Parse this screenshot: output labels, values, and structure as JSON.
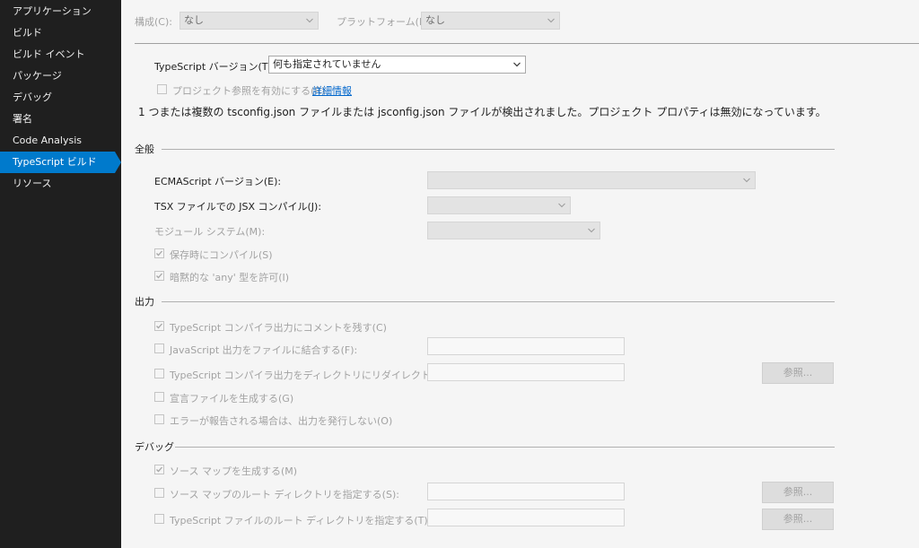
{
  "sidebar": {
    "items": [
      {
        "label": "アプリケーション"
      },
      {
        "label": "ビルド"
      },
      {
        "label": "ビルド イベント"
      },
      {
        "label": "パッケージ"
      },
      {
        "label": "デバッグ"
      },
      {
        "label": "署名"
      },
      {
        "label": "Code Analysis"
      },
      {
        "label": "TypeScript ビルド"
      },
      {
        "label": "リソース"
      }
    ],
    "active_index": 7
  },
  "header": {
    "config_label": "構成(C):",
    "config_value": "なし",
    "platform_label": "プラットフォーム(M):",
    "platform_value": "なし"
  },
  "ts_version": {
    "label": "TypeScript バージョン(T):",
    "value": "何も指定されていません"
  },
  "project_ref": {
    "label": "プロジェクト参照を有効にする(R)",
    "link": "詳細情報",
    "checked": false
  },
  "notice": "1 つまたは複数の tsconfig.json ファイルまたは jsconfig.json ファイルが検出されました。プロジェクト プロパティは無効になっています。",
  "general": {
    "title": "全般",
    "ecmascript_label": "ECMAScript バージョン(E):",
    "ecmascript_value": "",
    "jsx_label": "TSX ファイルでの JSX コンパイル(J):",
    "jsx_value": "",
    "module_label": "モジュール システム(M):",
    "module_value": "",
    "compile_on_save": {
      "label": "保存時にコンパイル(S)",
      "checked": true
    },
    "implicit_any": {
      "label": "暗黙的な 'any' 型を許可(I)",
      "checked": true
    }
  },
  "output": {
    "title": "出力",
    "keep_comments": {
      "label": "TypeScript コンパイラ出力にコメントを残す(C)",
      "checked": true
    },
    "combine_js": {
      "label": "JavaScript 出力をファイルに結合する(F):",
      "checked": false,
      "value": ""
    },
    "redirect_output": {
      "label": "TypeScript コンパイラ出力をディレクトリにリダイレクトする(D):",
      "checked": false,
      "value": ""
    },
    "browse_label": "参照...",
    "declaration": {
      "label": "宣言ファイルを生成する(G)",
      "checked": false
    },
    "no_emit_on_error": {
      "label": "エラーが報告される場合は、出力を発行しない(O)",
      "checked": false
    }
  },
  "debug": {
    "title": "デバッグ",
    "source_map": {
      "label": "ソース マップを生成する(M)",
      "checked": true
    },
    "map_root": {
      "label": "ソース マップのルート ディレクトリを指定する(S):",
      "checked": false,
      "value": ""
    },
    "ts_root": {
      "label": "TypeScript ファイルのルート ディレクトリを指定する(T):",
      "checked": false,
      "value": ""
    },
    "browse_label": "参照..."
  },
  "colors": {
    "sidebar_bg": "#1f1f1f",
    "accent": "#007acc",
    "link": "#0066cc"
  }
}
